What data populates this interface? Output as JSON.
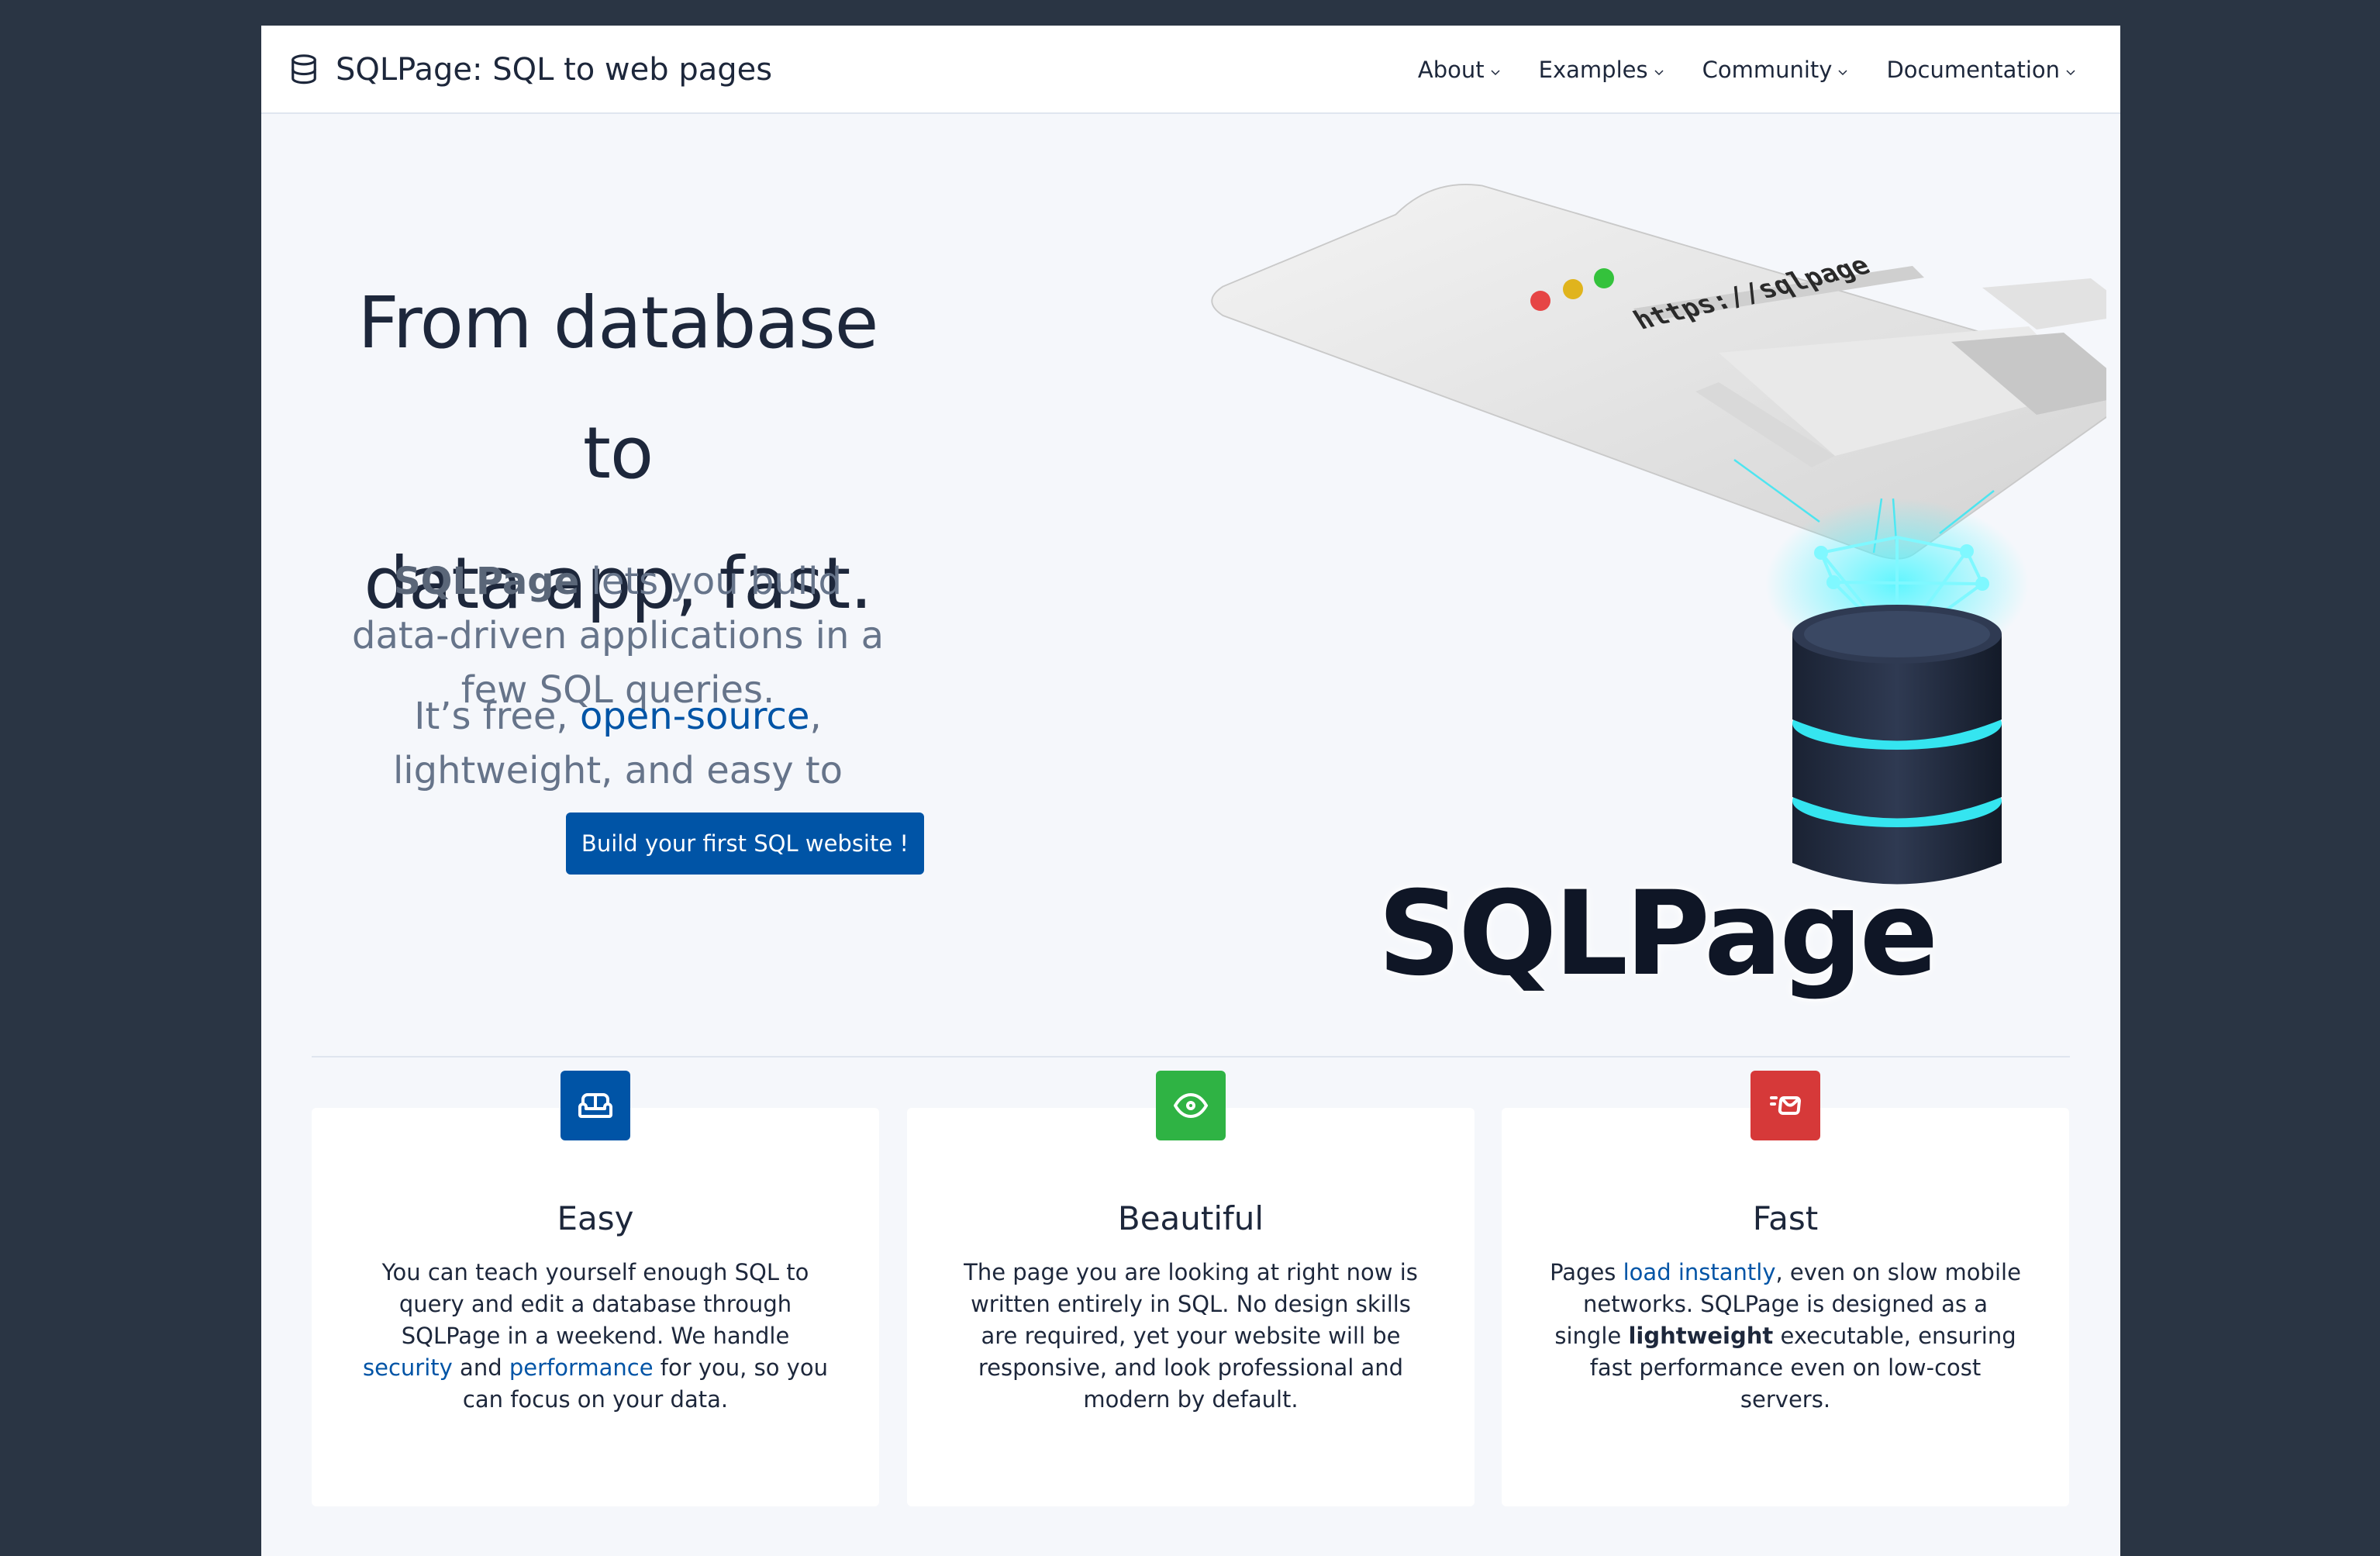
{
  "navbar": {
    "brand": "SQLPage: SQL to web pages",
    "items": [
      {
        "label": "About"
      },
      {
        "label": "Examples"
      },
      {
        "label": "Community"
      },
      {
        "label": "Documentation"
      }
    ]
  },
  "hero": {
    "title_line1": "From database to",
    "title_line2": "data app, fast.",
    "sub_bold": "SQLPage",
    "sub_rest": " lets you build data-driven applications in a few SQL queries.",
    "sub2_prefix": "It’s free, ",
    "sub2_link": "open-source",
    "sub2_suffix": ", lightweight, and easy to use.",
    "cta": "Build your first SQL website !",
    "illustration_url": "https://sqlpage",
    "logo": "SQLPage"
  },
  "features": [
    {
      "title": "Easy",
      "icon": "sofa-icon",
      "color": "#0054a6",
      "body_1": "You can teach yourself enough SQL to query and edit a database through SQLPage in a weekend. We handle ",
      "link_1": "security",
      "body_2": " and ",
      "link_2": "performance",
      "body_3": " for you, so you can focus on your data."
    },
    {
      "title": "Beautiful",
      "icon": "eye-icon",
      "color": "#2fb344",
      "body": "The page you are looking at right now is written entirely in SQL. No design skills are required, yet your website will be responsive, and look professional and modern by default."
    },
    {
      "title": "Fast",
      "icon": "mail-fast-icon",
      "color": "#d63939",
      "body_1": "Pages ",
      "link_1": "load instantly",
      "body_2": ", even on slow mobile networks. SQLPage is designed as a single ",
      "bold": "lightweight",
      "body_3": " executable, ensuring fast performance even on low-cost servers."
    }
  ]
}
